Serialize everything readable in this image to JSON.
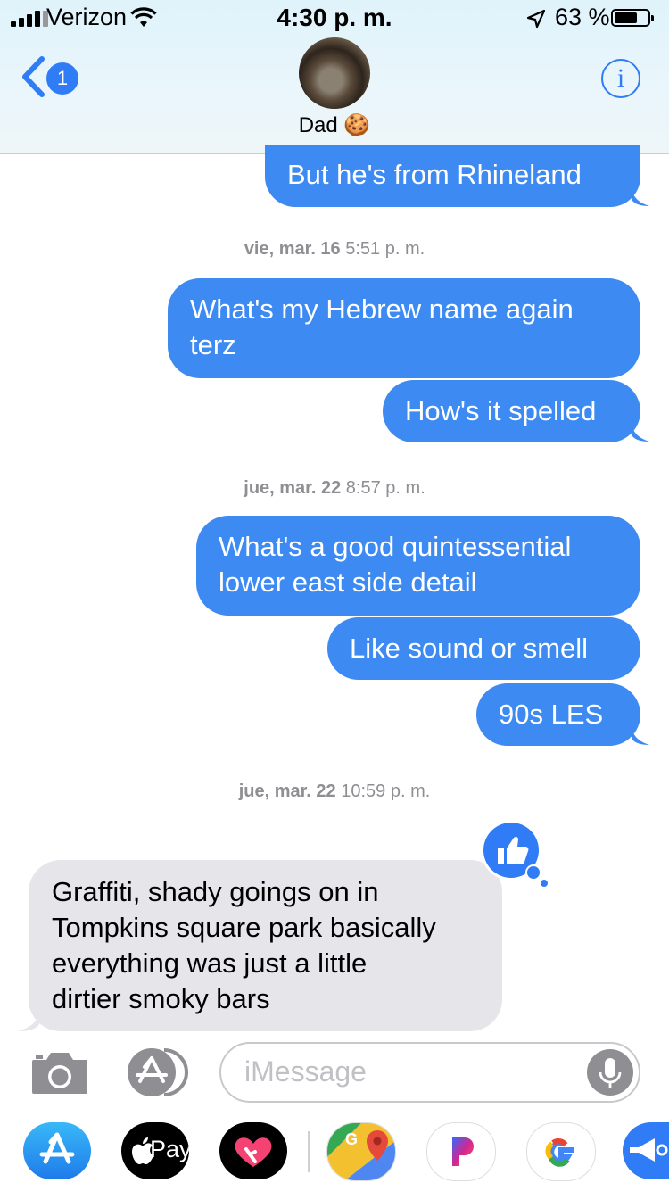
{
  "status_bar": {
    "carrier": "Verizon",
    "time": "4:30 p. m.",
    "battery": "63 %"
  },
  "header": {
    "back_badge": "1",
    "contact_name": "Dad 🍪",
    "info_label": "i"
  },
  "messages": [
    {
      "type": "sent",
      "text": "But he's from Rhineland"
    },
    {
      "type": "timestamp",
      "day": "vie, mar. 16",
      "time": "5:51 p. m."
    },
    {
      "type": "sent",
      "lines": [
        "What's my Hebrew name again",
        "terz"
      ]
    },
    {
      "type": "sent",
      "text": "How's it spelled"
    },
    {
      "type": "timestamp",
      "day": "jue, mar. 22",
      "time": "8:57 p. m."
    },
    {
      "type": "sent",
      "lines": [
        "What's a good quintessential",
        "lower east side detail"
      ]
    },
    {
      "type": "sent",
      "text": "Like sound or smell"
    },
    {
      "type": "sent",
      "text": "90s LES"
    },
    {
      "type": "timestamp",
      "day": "jue, mar. 22",
      "time": "10:59 p. m."
    },
    {
      "type": "received",
      "lines": [
        "Graffiti, shady goings on in",
        "Tompkins square park basically",
        "everything was just a little",
        "dirtier smoky bars"
      ],
      "tapback": "thumbs-up-icon"
    }
  ],
  "composer": {
    "placeholder": "iMessage"
  },
  "app_drawer": {
    "apps": [
      {
        "name": "app-store-icon"
      },
      {
        "name": "apple-pay-icon",
        "label": "Pay"
      },
      {
        "name": "digital-touch-icon"
      },
      {
        "name": "google-maps-icon"
      },
      {
        "name": "pandora-icon"
      },
      {
        "name": "google-icon"
      },
      {
        "name": "more-app-icon"
      }
    ]
  },
  "colors": {
    "sent_bubble": "#3c8af2",
    "received_bubble": "#e5e5ea",
    "accent": "#2f7cf6"
  }
}
